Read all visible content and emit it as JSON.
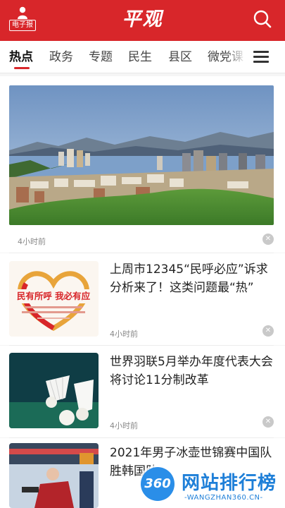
{
  "header": {
    "epaper_label": "电子报",
    "brand": "平观",
    "search_icon": "search-icon",
    "accent_color": "#d8262a"
  },
  "tabs": [
    {
      "label": "热点",
      "active": true
    },
    {
      "label": "政务",
      "active": false
    },
    {
      "label": "专题",
      "active": false
    },
    {
      "label": "民生",
      "active": false
    },
    {
      "label": "县区",
      "active": false
    },
    {
      "label": "微党课",
      "active": false
    }
  ],
  "feed": [
    {
      "type": "big",
      "time": "4小时前",
      "image": "city-lake-aerial-photo"
    },
    {
      "type": "thumb",
      "title": "上周市12345“民呼必应”诉求分析来了！这类问题最“热”",
      "time": "4小时前",
      "image_caption": "民有所呼  我必有应"
    },
    {
      "type": "thumb",
      "title": "世界羽联5月举办年度代表大会 将讨论11分制改革",
      "time": "4小时前",
      "image": "shuttlecock-photo"
    },
    {
      "type": "thumb",
      "title": "2021年男子冰壶世锦赛中国队胜韩国队",
      "image": "curling-photo"
    }
  ],
  "watermark": {
    "logo_text": "360",
    "title": "网站排行榜",
    "subtitle": "-WANGZHAN360.CN-"
  }
}
